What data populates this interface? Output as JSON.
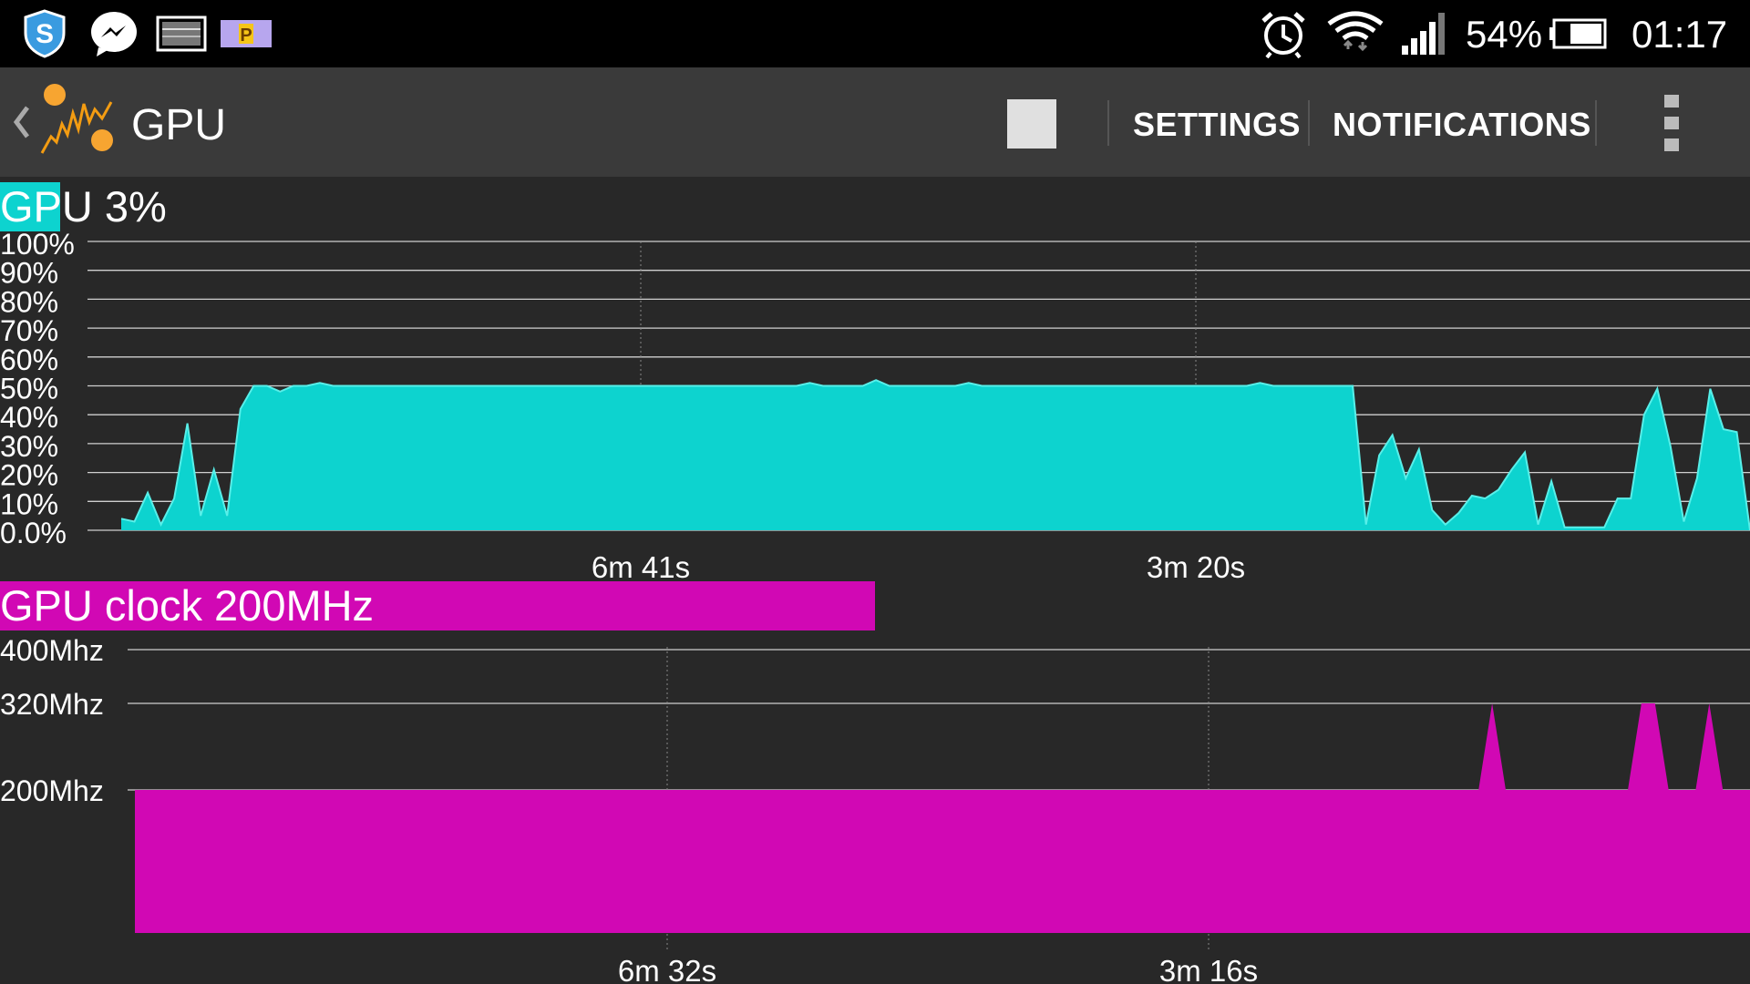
{
  "status_bar": {
    "notification_icons": [
      "shield-icon",
      "messenger-icon",
      "screenshot-icon",
      "p-app-icon"
    ],
    "system_icons": [
      "alarm-icon",
      "wifi-icon",
      "signal-icon",
      "battery-icon"
    ],
    "battery_percent": "54%",
    "time": "01:17"
  },
  "action_bar": {
    "title": "GPU",
    "actions": {
      "settings": "SETTINGS",
      "notifications": "NOTIFICATIONS"
    },
    "icons": [
      "back-chevron-icon",
      "app-logo-icon",
      "stop-icon",
      "overflow-menu-icon"
    ]
  },
  "gpu_usage": {
    "title": "GPU 3%",
    "highlight_fraction": 0.03,
    "color": "#0dd3cf",
    "y_ticks": [
      "100%",
      "90%",
      "80%",
      "70%",
      "60%",
      "50%",
      "40%",
      "30%",
      "20%",
      "10%",
      "0.0%"
    ],
    "x_ticks": [
      "6m 41s",
      "3m 20s"
    ]
  },
  "gpu_clock": {
    "title": "GPU clock 200MHz",
    "highlight_fraction": 0.5,
    "color": "#d108b4",
    "y_ticks": [
      "400Mhz",
      "320Mhz",
      "200Mhz"
    ],
    "x_ticks": [
      "6m 32s",
      "3m 16s"
    ]
  },
  "chart_data": [
    {
      "type": "area",
      "title": "GPU 3%",
      "ylabel": "",
      "xlabel": "",
      "ylim": [
        0,
        100
      ],
      "y_unit": "%",
      "x_ticks": [
        "6m 41s",
        "3m 20s"
      ],
      "series": [
        {
          "values": [
            4,
            3,
            13,
            2,
            11,
            37,
            5,
            21,
            5,
            42,
            50,
            50,
            48,
            50,
            50,
            51,
            50,
            50,
            50,
            50,
            50,
            50,
            50,
            50,
            50,
            50,
            50,
            50,
            50,
            50,
            50,
            50,
            50,
            50,
            50,
            50,
            50,
            50,
            50,
            50,
            50,
            50,
            50,
            50,
            50,
            50,
            50,
            50,
            50,
            50,
            50,
            50,
            51,
            50,
            50,
            50,
            50,
            52,
            50,
            50,
            50,
            50,
            50,
            50,
            51,
            50,
            50,
            50,
            50,
            50,
            50,
            50,
            50,
            50,
            50,
            50,
            50,
            50,
            50,
            50,
            50,
            50,
            50,
            50,
            50,
            50,
            51,
            50,
            50,
            50,
            50,
            50,
            50,
            50,
            2,
            26,
            33,
            18,
            28,
            7,
            2,
            6,
            12,
            11,
            14,
            21,
            27,
            2,
            17,
            1,
            1,
            1,
            1,
            11,
            11,
            40,
            49,
            29,
            3,
            18,
            49,
            35,
            34,
            0
          ]
        }
      ]
    },
    {
      "type": "area",
      "title": "GPU clock 200MHz",
      "ylabel": "",
      "xlabel": "",
      "y_ticks": [
        "400Mhz",
        "320Mhz",
        "200Mhz"
      ],
      "y_tick_values": [
        400,
        320,
        200
      ],
      "x_ticks": [
        "6m 32s",
        "3m 16s"
      ],
      "series": [
        {
          "values": [
            200,
            200,
            200,
            200,
            200,
            200,
            200,
            200,
            200,
            200,
            200,
            200,
            200,
            200,
            200,
            200,
            200,
            200,
            200,
            200,
            200,
            200,
            200,
            200,
            200,
            200,
            200,
            200,
            200,
            200,
            200,
            200,
            200,
            200,
            200,
            200,
            200,
            200,
            200,
            200,
            200,
            200,
            200,
            200,
            200,
            200,
            200,
            200,
            200,
            200,
            200,
            200,
            200,
            200,
            200,
            200,
            200,
            200,
            200,
            200,
            200,
            200,
            200,
            200,
            200,
            200,
            200,
            200,
            200,
            200,
            200,
            200,
            200,
            200,
            200,
            200,
            200,
            200,
            200,
            200,
            200,
            200,
            200,
            200,
            200,
            200,
            200,
            200,
            200,
            200,
            200,
            200,
            200,
            200,
            200,
            200,
            200,
            200,
            200,
            200,
            320,
            200,
            200,
            200,
            200,
            200,
            200,
            200,
            200,
            200,
            200,
            320,
            320,
            200,
            200,
            200,
            320,
            200,
            200,
            200
          ]
        }
      ]
    }
  ]
}
